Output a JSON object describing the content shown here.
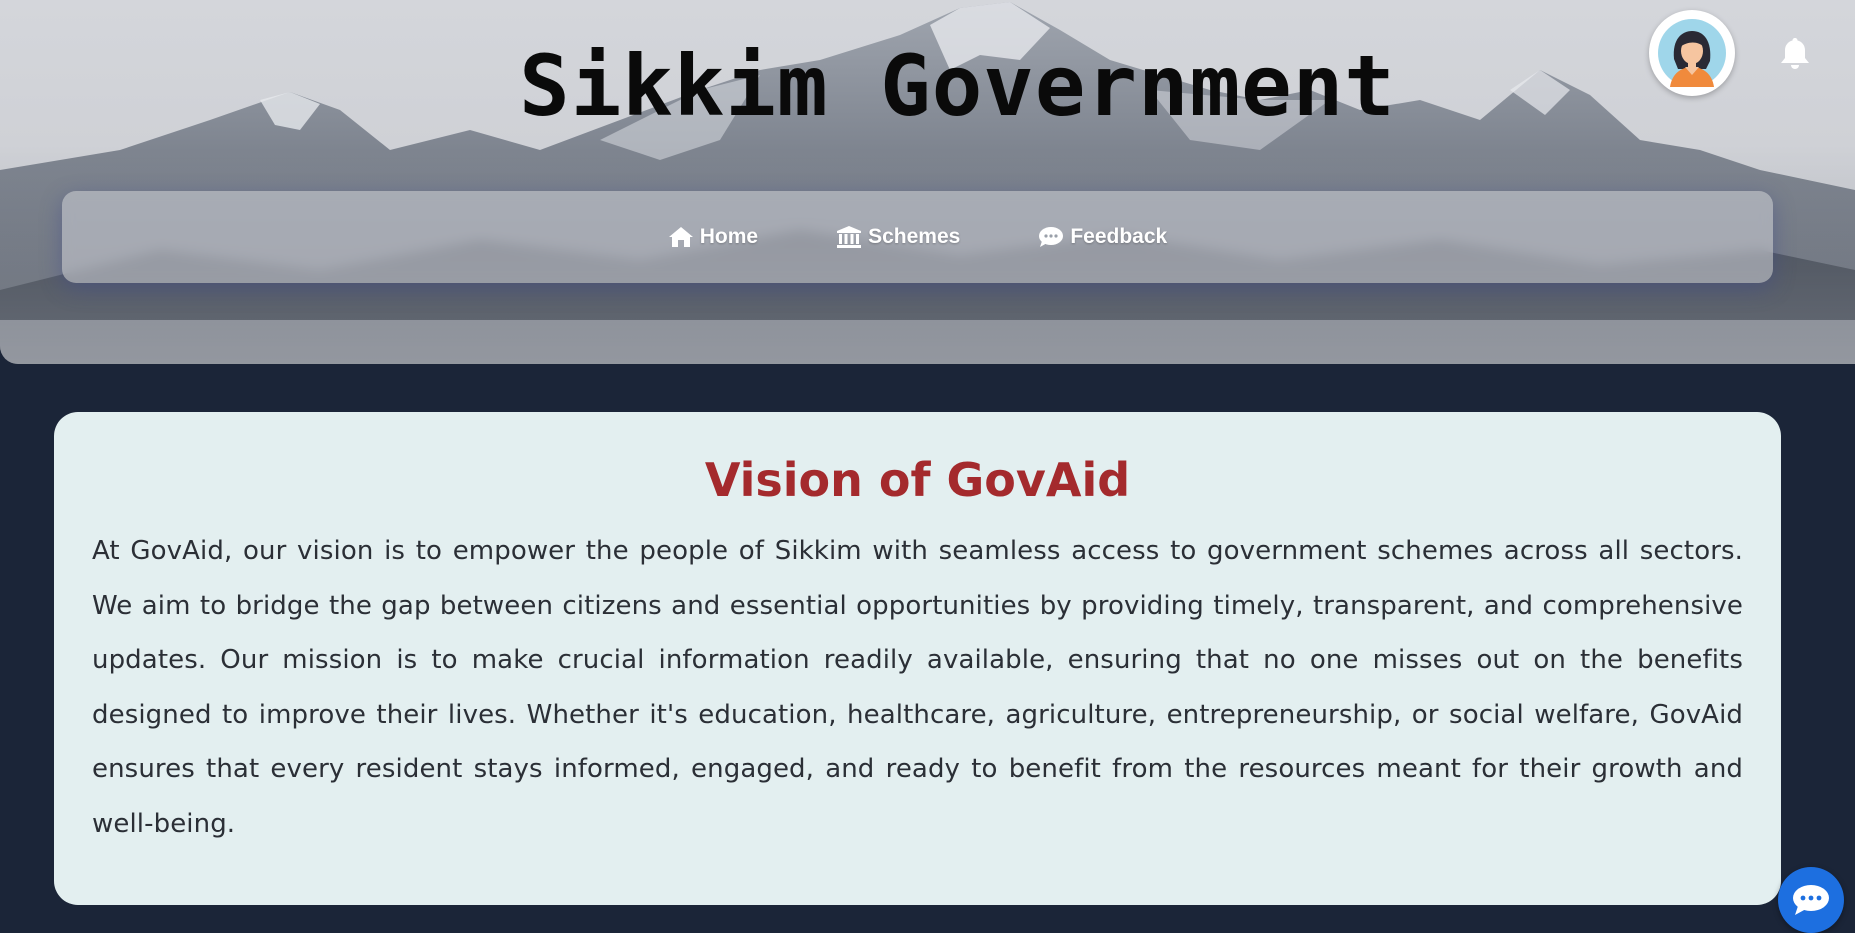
{
  "header": {
    "title": "Sikkim Government"
  },
  "icons": {
    "avatar": "user-avatar-icon",
    "notifications": "bell-icon",
    "chat": "chat-bubble-icon"
  },
  "nav": {
    "items": [
      {
        "label": "Home",
        "icon": "home-icon"
      },
      {
        "label": "Schemes",
        "icon": "bank-icon"
      },
      {
        "label": "Feedback",
        "icon": "comment-icon"
      }
    ]
  },
  "vision": {
    "title": "Vision of GovAid",
    "body": "At GovAid, our vision is to empower the people of Sikkim with seamless access to government schemes across all sectors. We aim to bridge the gap between citizens and essential opportunities by providing timely, transparent, and comprehensive updates. Our mission is to make crucial information readily available, ensuring that no one misses out on the benefits designed to improve their lives. Whether it's education, healthcare, agriculture, entrepreneurship, or social welfare, GovAid ensures that every resident stays informed, engaged, and ready to benefit from the resources meant for their growth and well-being."
  },
  "colors": {
    "page_background": "#1b2538",
    "card_background": "#e3eff0",
    "vision_title": "#a42a2d",
    "chat_button": "#1d6fe0"
  }
}
